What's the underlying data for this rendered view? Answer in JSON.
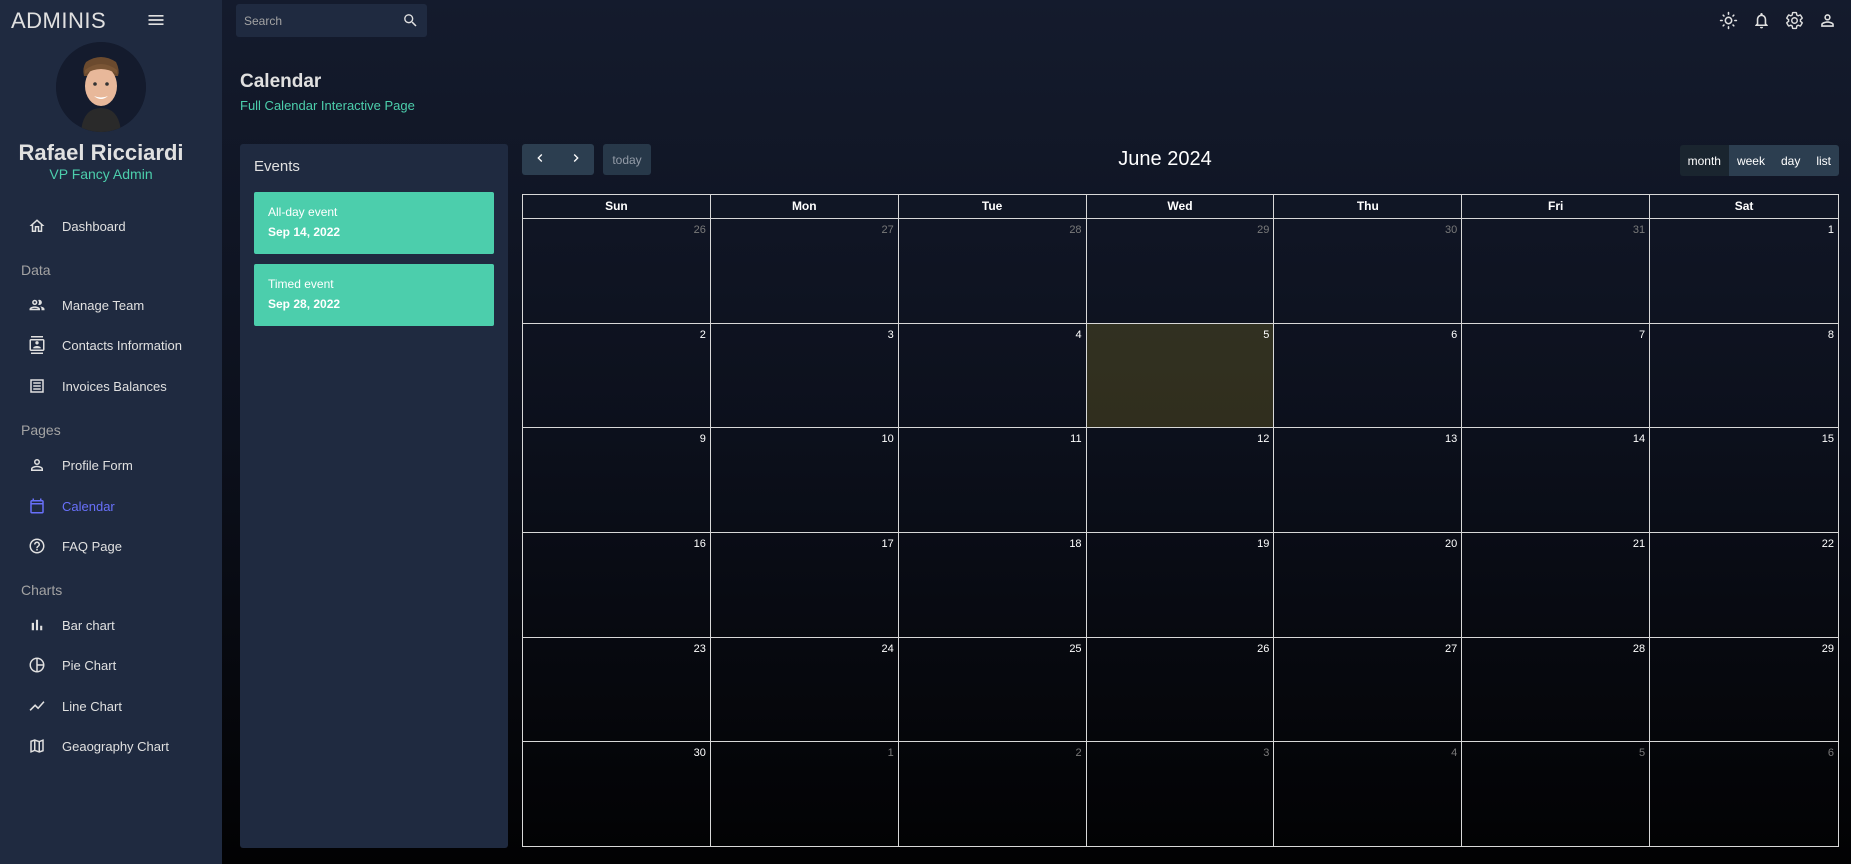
{
  "sidebar": {
    "brand": "ADMINIS",
    "user_name": "Rafael Ricciardi",
    "user_role": "VP Fancy Admin",
    "items": [
      {
        "label": "Dashboard",
        "icon": "home-icon"
      },
      {
        "section": "Data"
      },
      {
        "label": "Manage Team",
        "icon": "people-icon"
      },
      {
        "label": "Contacts Information",
        "icon": "contacts-icon"
      },
      {
        "label": "Invoices Balances",
        "icon": "receipt-icon"
      },
      {
        "section": "Pages"
      },
      {
        "label": "Profile Form",
        "icon": "person-icon"
      },
      {
        "label": "Calendar",
        "icon": "calendar-icon",
        "active": true
      },
      {
        "label": "FAQ Page",
        "icon": "help-icon"
      },
      {
        "section": "Charts"
      },
      {
        "label": "Bar chart",
        "icon": "bar-chart-icon"
      },
      {
        "label": "Pie Chart",
        "icon": "pie-chart-icon"
      },
      {
        "label": "Line Chart",
        "icon": "line-chart-icon"
      },
      {
        "label": "Geaography Chart",
        "icon": "map-icon"
      }
    ]
  },
  "topbar": {
    "search_placeholder": "Search",
    "icons": [
      "light-mode-icon",
      "notifications-icon",
      "settings-icon",
      "person-icon"
    ]
  },
  "header": {
    "title": "Calendar",
    "subtitle": "Full Calendar Interactive Page"
  },
  "events": {
    "title": "Events",
    "items": [
      {
        "title": "All-day event",
        "date": "Sep 14, 2022"
      },
      {
        "title": "Timed event",
        "date": "Sep 28, 2022"
      }
    ]
  },
  "calendar": {
    "title": "June 2024",
    "today_label": "today",
    "views": [
      "month",
      "week",
      "day",
      "list"
    ],
    "weekdays": [
      "Sun",
      "Mon",
      "Tue",
      "Wed",
      "Thu",
      "Fri",
      "Sat"
    ],
    "days": [
      {
        "d": "26",
        "other": true
      },
      {
        "d": "27",
        "other": true
      },
      {
        "d": "28",
        "other": true
      },
      {
        "d": "29",
        "other": true
      },
      {
        "d": "30",
        "other": true
      },
      {
        "d": "31",
        "other": true
      },
      {
        "d": "1"
      },
      {
        "d": "2"
      },
      {
        "d": "3"
      },
      {
        "d": "4"
      },
      {
        "d": "5",
        "today": true
      },
      {
        "d": "6"
      },
      {
        "d": "7"
      },
      {
        "d": "8"
      },
      {
        "d": "9"
      },
      {
        "d": "10"
      },
      {
        "d": "11"
      },
      {
        "d": "12"
      },
      {
        "d": "13"
      },
      {
        "d": "14"
      },
      {
        "d": "15"
      },
      {
        "d": "16"
      },
      {
        "d": "17"
      },
      {
        "d": "18"
      },
      {
        "d": "19"
      },
      {
        "d": "20"
      },
      {
        "d": "21"
      },
      {
        "d": "22"
      },
      {
        "d": "23"
      },
      {
        "d": "24"
      },
      {
        "d": "25"
      },
      {
        "d": "26"
      },
      {
        "d": "27"
      },
      {
        "d": "28"
      },
      {
        "d": "29"
      },
      {
        "d": "30"
      },
      {
        "d": "1",
        "other": true
      },
      {
        "d": "2",
        "other": true
      },
      {
        "d": "3",
        "other": true
      },
      {
        "d": "4",
        "other": true
      },
      {
        "d": "5",
        "other": true
      },
      {
        "d": "6",
        "other": true
      }
    ]
  },
  "colors": {
    "accent_green": "#4cceac",
    "active_blue": "#6870fa",
    "panel": "#1f2a40",
    "background": "#141b2d"
  }
}
